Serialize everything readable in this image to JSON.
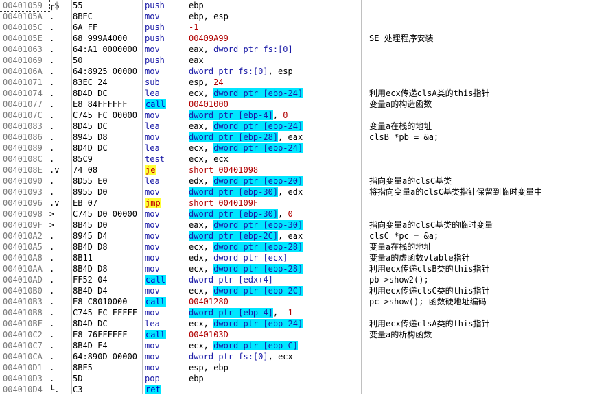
{
  "rows": [
    {
      "addr": "00401059",
      "gutter": "┌$",
      "hex": "55",
      "mnemonic": "push",
      "operands": [
        {
          "t": "ebp"
        }
      ],
      "comment": ""
    },
    {
      "addr": "0040105A",
      "gutter": ".",
      "hex": "8BEC",
      "mnemonic": "mov",
      "operands": [
        {
          "t": "ebp, esp"
        }
      ],
      "comment": ""
    },
    {
      "addr": "0040105C",
      "gutter": ".",
      "hex": "6A FF",
      "mnemonic": "push",
      "operands": [
        {
          "t": "-1",
          "c": "red"
        }
      ],
      "comment": ""
    },
    {
      "addr": "0040105E",
      "gutter": ".",
      "hex": "68 999A4000",
      "mnemonic": "push",
      "operands": [
        {
          "t": "00409A99",
          "c": "red"
        }
      ],
      "comment": "SE 处理程序安装"
    },
    {
      "addr": "00401063",
      "gutter": ".",
      "hex": "64:A1 0000000",
      "mnemonic": "mov",
      "operands": [
        {
          "t": "eax, "
        },
        {
          "t": "dword ptr fs:[0]",
          "c": "bl"
        }
      ],
      "comment": ""
    },
    {
      "addr": "00401069",
      "gutter": ".",
      "hex": "50",
      "mnemonic": "push",
      "operands": [
        {
          "t": "eax"
        }
      ],
      "comment": ""
    },
    {
      "addr": "0040106A",
      "gutter": ".",
      "hex": "64:8925 00000",
      "mnemonic": "mov",
      "operands": [
        {
          "t": "dword ptr fs:[0]",
          "c": "bl"
        },
        {
          "t": ", esp"
        }
      ],
      "comment": ""
    },
    {
      "addr": "00401071",
      "gutter": ".",
      "hex": "83EC 24",
      "mnemonic": "sub",
      "operands": [
        {
          "t": "esp, "
        },
        {
          "t": "24",
          "c": "red"
        }
      ],
      "comment": ""
    },
    {
      "addr": "00401074",
      "gutter": ".",
      "hex": "8D4D DC",
      "mnemonic": "lea",
      "operands": [
        {
          "t": "ecx, "
        },
        {
          "t": "dword ptr [ebp-24]",
          "h": true
        }
      ],
      "comment": "利用ecx传递clsA类的this指针"
    },
    {
      "addr": "00401077",
      "gutter": ".",
      "hex": "E8 84FFFFFF",
      "mnemonic": "call",
      "operands": [
        {
          "t": "00401000",
          "c": "red"
        }
      ],
      "comment": "变量a的构造函数"
    },
    {
      "addr": "0040107C",
      "gutter": ".",
      "hex": "C745 FC 00000",
      "mnemonic": "mov",
      "operands": [
        {
          "t": "dword ptr [ebp-4]",
          "h": true
        },
        {
          "t": ", "
        },
        {
          "t": "0",
          "c": "red"
        }
      ],
      "comment": ""
    },
    {
      "addr": "00401083",
      "gutter": ".",
      "hex": "8D45 DC",
      "mnemonic": "lea",
      "operands": [
        {
          "t": "eax, "
        },
        {
          "t": "dword ptr [ebp-24]",
          "h": true
        }
      ],
      "comment": "变量a在栈的地址"
    },
    {
      "addr": "00401086",
      "gutter": ".",
      "hex": "8945 D8",
      "mnemonic": "mov",
      "operands": [
        {
          "t": "dword ptr [ebp-28]",
          "h": true
        },
        {
          "t": ", eax"
        }
      ],
      "comment": "clsB *pb = &a;"
    },
    {
      "addr": "00401089",
      "gutter": ".",
      "hex": "8D4D DC",
      "mnemonic": "lea",
      "operands": [
        {
          "t": "ecx, "
        },
        {
          "t": "dword ptr [ebp-24]",
          "h": true
        }
      ],
      "comment": ""
    },
    {
      "addr": "0040108C",
      "gutter": ".",
      "hex": "85C9",
      "mnemonic": "test",
      "operands": [
        {
          "t": "ecx, ecx"
        }
      ],
      "comment": ""
    },
    {
      "addr": "0040108E",
      "gutter": ".v",
      "hex": "74 08",
      "mnemonic": "je",
      "operands": [
        {
          "t": "short 00401098",
          "c": "red"
        }
      ],
      "comment": ""
    },
    {
      "addr": "00401090",
      "gutter": ".",
      "hex": "8D55 E0",
      "mnemonic": "lea",
      "operands": [
        {
          "t": "edx, "
        },
        {
          "t": "dword ptr [ebp-20]",
          "h": true
        }
      ],
      "comment": "指向变量a的clsC基类"
    },
    {
      "addr": "00401093",
      "gutter": ".",
      "hex": "8955 D0",
      "mnemonic": "mov",
      "operands": [
        {
          "t": "dword ptr [ebp-30]",
          "h": true
        },
        {
          "t": ", edx"
        }
      ],
      "comment": "将指向变量a的clsC基类指针保留到临时变量中"
    },
    {
      "addr": "00401096",
      "gutter": ".v",
      "hex": "EB 07",
      "mnemonic": "jmp",
      "operands": [
        {
          "t": "short 0040109F",
          "c": "red"
        }
      ],
      "comment": ""
    },
    {
      "addr": "00401098",
      "gutter": ">",
      "hex": "C745 D0 00000",
      "mnemonic": "mov",
      "operands": [
        {
          "t": "dword ptr [ebp-30]",
          "h": true
        },
        {
          "t": ", "
        },
        {
          "t": "0",
          "c": "red"
        }
      ],
      "comment": ""
    },
    {
      "addr": "0040109F",
      "gutter": ">",
      "hex": "8B45 D0",
      "mnemonic": "mov",
      "operands": [
        {
          "t": "eax, "
        },
        {
          "t": "dword ptr [ebp-30]",
          "h": true
        }
      ],
      "comment": "指向变量a的clsC基类的临时变量"
    },
    {
      "addr": "004010A2",
      "gutter": ".",
      "hex": "8945 D4",
      "mnemonic": "mov",
      "operands": [
        {
          "t": "dword ptr [ebp-2C]",
          "h": true
        },
        {
          "t": ", eax"
        }
      ],
      "comment": "clsC *pc = &a;"
    },
    {
      "addr": "004010A5",
      "gutter": ".",
      "hex": "8B4D D8",
      "mnemonic": "mov",
      "operands": [
        {
          "t": "ecx, "
        },
        {
          "t": "dword ptr [ebp-28]",
          "h": true
        }
      ],
      "comment": "变量a在栈的地址"
    },
    {
      "addr": "004010A8",
      "gutter": ".",
      "hex": "8B11",
      "mnemonic": "mov",
      "operands": [
        {
          "t": "edx, "
        },
        {
          "t": "dword ptr [ecx]",
          "c": "bl"
        }
      ],
      "comment": "变量a的虚函数vtable指针"
    },
    {
      "addr": "004010AA",
      "gutter": ".",
      "hex": "8B4D D8",
      "mnemonic": "mov",
      "operands": [
        {
          "t": "ecx, "
        },
        {
          "t": "dword ptr [ebp-28]",
          "h": true
        }
      ],
      "comment": "利用ecx传递clsB类的this指针"
    },
    {
      "addr": "004010AD",
      "gutter": ".",
      "hex": "FF52 04",
      "mnemonic": "call",
      "operands": [
        {
          "t": "dword ptr [edx+4]",
          "c": "bl"
        }
      ],
      "comment": "pb->show2();"
    },
    {
      "addr": "004010B0",
      "gutter": ".",
      "hex": "8B4D D4",
      "mnemonic": "mov",
      "operands": [
        {
          "t": "ecx, "
        },
        {
          "t": "dword ptr [ebp-2C]",
          "h": true
        }
      ],
      "comment": "利用ecx传递clsC类的this指针"
    },
    {
      "addr": "004010B3",
      "gutter": ".",
      "hex": "E8 C8010000",
      "mnemonic": "call",
      "operands": [
        {
          "t": "00401280",
          "c": "red"
        }
      ],
      "comment": "pc->show(); 函数硬地址编码"
    },
    {
      "addr": "004010B8",
      "gutter": ".",
      "hex": "C745 FC FFFFF",
      "mnemonic": "mov",
      "operands": [
        {
          "t": "dword ptr [ebp-4]",
          "h": true
        },
        {
          "t": ", "
        },
        {
          "t": "-1",
          "c": "red"
        }
      ],
      "comment": ""
    },
    {
      "addr": "004010BF",
      "gutter": ".",
      "hex": "8D4D DC",
      "mnemonic": "lea",
      "operands": [
        {
          "t": "ecx, "
        },
        {
          "t": "dword ptr [ebp-24]",
          "h": true
        }
      ],
      "comment": "利用ecx传递clsA类的this指针"
    },
    {
      "addr": "004010C2",
      "gutter": ".",
      "hex": "E8 76FFFFFF",
      "mnemonic": "call",
      "operands": [
        {
          "t": "0040103D",
          "c": "red"
        }
      ],
      "comment": "变量a的析构函数"
    },
    {
      "addr": "004010C7",
      "gutter": ".",
      "hex": "8B4D F4",
      "mnemonic": "mov",
      "operands": [
        {
          "t": "ecx, "
        },
        {
          "t": "dword ptr [ebp-C]",
          "h": true
        }
      ],
      "comment": ""
    },
    {
      "addr": "004010CA",
      "gutter": ".",
      "hex": "64:890D 00000",
      "mnemonic": "mov",
      "operands": [
        {
          "t": "dword ptr fs:[0]",
          "c": "bl"
        },
        {
          "t": ", ecx"
        }
      ],
      "comment": ""
    },
    {
      "addr": "004010D1",
      "gutter": ".",
      "hex": "8BE5",
      "mnemonic": "mov",
      "operands": [
        {
          "t": "esp, ebp"
        }
      ],
      "comment": ""
    },
    {
      "addr": "004010D3",
      "gutter": ".",
      "hex": "5D",
      "mnemonic": "pop",
      "operands": [
        {
          "t": "ebp"
        }
      ],
      "comment": ""
    },
    {
      "addr": "004010D4",
      "gutter": "└.",
      "hex": "C3",
      "mnemonic": "ret",
      "operands": [],
      "comment": ""
    }
  ],
  "colors": {
    "address": "#7a7a7a",
    "keyword": "#1a1aa6",
    "constant": "#b00000",
    "operand_highlight": "#00e6ff",
    "call_highlight": "#00e6ff",
    "jump_highlight": "#ffff33",
    "separator": "#c0c0c0"
  }
}
